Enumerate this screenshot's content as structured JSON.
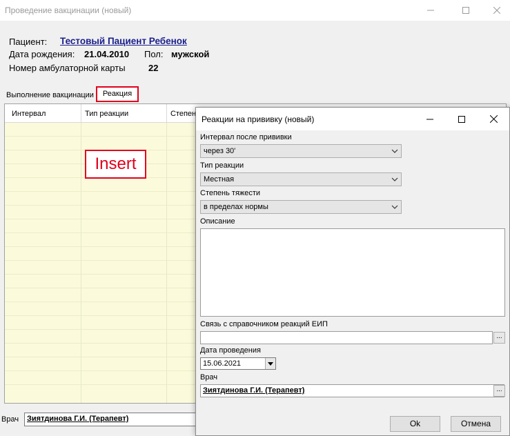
{
  "window": {
    "title": "Проведение вакцинации (новый)"
  },
  "patient": {
    "label": "Пациент:",
    "name": "Тестовый Пациент Ребенок",
    "dob_label": "Дата рождения:",
    "dob": "21.04.2010",
    "sex_label": "Пол:",
    "sex": "мужской",
    "card_label": "Номер амбулаторной карты",
    "card": "22"
  },
  "tabs": [
    {
      "label": "Выполнение вакцинации",
      "active": false
    },
    {
      "label": "Реакция",
      "active": true
    }
  ],
  "grid": {
    "columns": [
      "Интервал",
      "Тип реакции",
      "Степень"
    ]
  },
  "annotation": {
    "text": "Insert",
    "color": "#e0001b"
  },
  "main_doctor": {
    "label": "Врач",
    "value": "Зиятдинова Г.И. (Терапевт)"
  },
  "dialog": {
    "title": "Реакции на прививку (новый)",
    "interval": {
      "label": "Интервал после прививки",
      "value": "через 30'"
    },
    "type": {
      "label": "Тип реакции",
      "value": "Местная"
    },
    "severity": {
      "label": "Степень тяжести",
      "value": "в пределах нормы"
    },
    "description": {
      "label": "Описание",
      "value": ""
    },
    "eip": {
      "label": "Связь с справочником реакций ЕИП",
      "value": "",
      "button": "..."
    },
    "date": {
      "label": "Дата проведения",
      "value": "15.06.2021"
    },
    "doctor": {
      "label": "Врач",
      "value": "Зиятдинова Г.И. (Терапевт)",
      "button": "..."
    },
    "ok_label": "Ok",
    "cancel_label": "Отмена"
  }
}
